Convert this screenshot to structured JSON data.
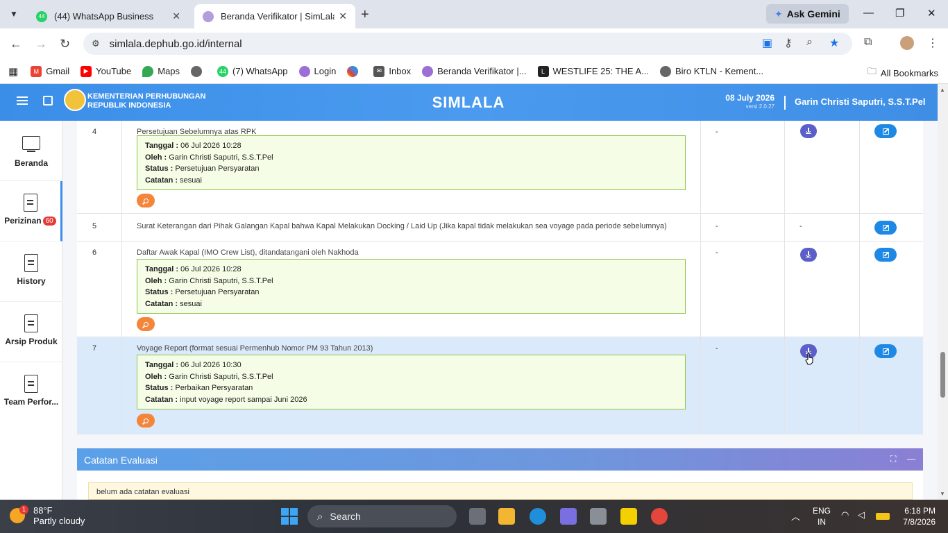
{
  "browser": {
    "tabs": [
      {
        "title": "(44) WhatsApp Business",
        "favicon_text": "44"
      },
      {
        "title": "Beranda Verifikator | SimLala"
      }
    ],
    "gemini_label": "Ask Gemini",
    "url": "simlala.dephub.go.id/internal",
    "bookmarks": [
      "Gmail",
      "YouTube",
      "Maps",
      "(7) WhatsApp",
      "Login",
      "Inbox",
      "Beranda Verifikator |...",
      "WESTLIFE 25: THE A...",
      "Biro KTLN - Kement..."
    ],
    "bookmark_badge": "44",
    "all_bookmarks": "All Bookmarks"
  },
  "header": {
    "ministry_line1": "KEMENTERIAN PERHUBUNGAN",
    "ministry_line2": "REPUBLIK INDONESIA",
    "app_title": "SIMLALA",
    "date": "08 July 2026",
    "version": "versi 2.0.27",
    "user": "Garin Christi Saputri, S.S.T.Pel"
  },
  "sidebar": {
    "items": [
      {
        "label": "Beranda"
      },
      {
        "label": "Perizinan",
        "badge": "60"
      },
      {
        "label": "History"
      },
      {
        "label": "Arsip Produk"
      },
      {
        "label": "Team Perfor..."
      }
    ]
  },
  "labels": {
    "tanggal": "Tanggal :",
    "oleh": "Oleh :",
    "status": "Status :",
    "catatan": "Catatan :",
    "dash": "-"
  },
  "rows": [
    {
      "num": "4",
      "desc": "Persetujuan Sebelumnya atas RPK",
      "tanggal": "06 Jul 2026 10:28",
      "oleh": "Garin Christi Saputri, S.S.T.Pel",
      "status": "Persetujuan Persyaratan",
      "catatan": "sesuai"
    },
    {
      "num": "5",
      "desc": "Surat Keterangan dari Pihak Galangan Kapal bahwa Kapal Melakukan Docking / Laid Up (Jika kapal tidak melakukan sea voyage pada periode sebelumnya)"
    },
    {
      "num": "6",
      "desc": "Daftar Awak Kapal (IMO Crew List), ditandatangani oleh Nakhoda",
      "tanggal": "06 Jul 2026 10:28",
      "oleh": "Garin Christi Saputri, S.S.T.Pel",
      "status": "Persetujuan Persyaratan",
      "catatan": "sesuai"
    },
    {
      "num": "7",
      "desc": "Voyage Report (format sesuai Permenhub Nomor PM 93 Tahun 2013)",
      "tanggal": "06 Jul 2026 10:30",
      "oleh": "Garin Christi Saputri, S.S.T.Pel",
      "status": "Perbaikan Persyaratan",
      "catatan": "input voyage report sampai Juni 2026"
    }
  ],
  "evaluasi": {
    "title": "Catatan Evaluasi",
    "body": "belum ada catatan evaluasi"
  },
  "taskbar": {
    "temp": "88°F",
    "weather": "Partly cloudy",
    "weather_badge": "1",
    "search_placeholder": "Search",
    "lang1": "ENG",
    "lang2": "IN",
    "time": "6:18 PM",
    "date": "7/8/2026"
  },
  "colors": {
    "header_blue": "#3b8ee8",
    "info_green": "#8bc34a",
    "zoom_orange": "#f4863c",
    "download_purple": "#5b5fc7",
    "edit_blue": "#1e88e5",
    "highlight_row": "#dbeafb"
  }
}
